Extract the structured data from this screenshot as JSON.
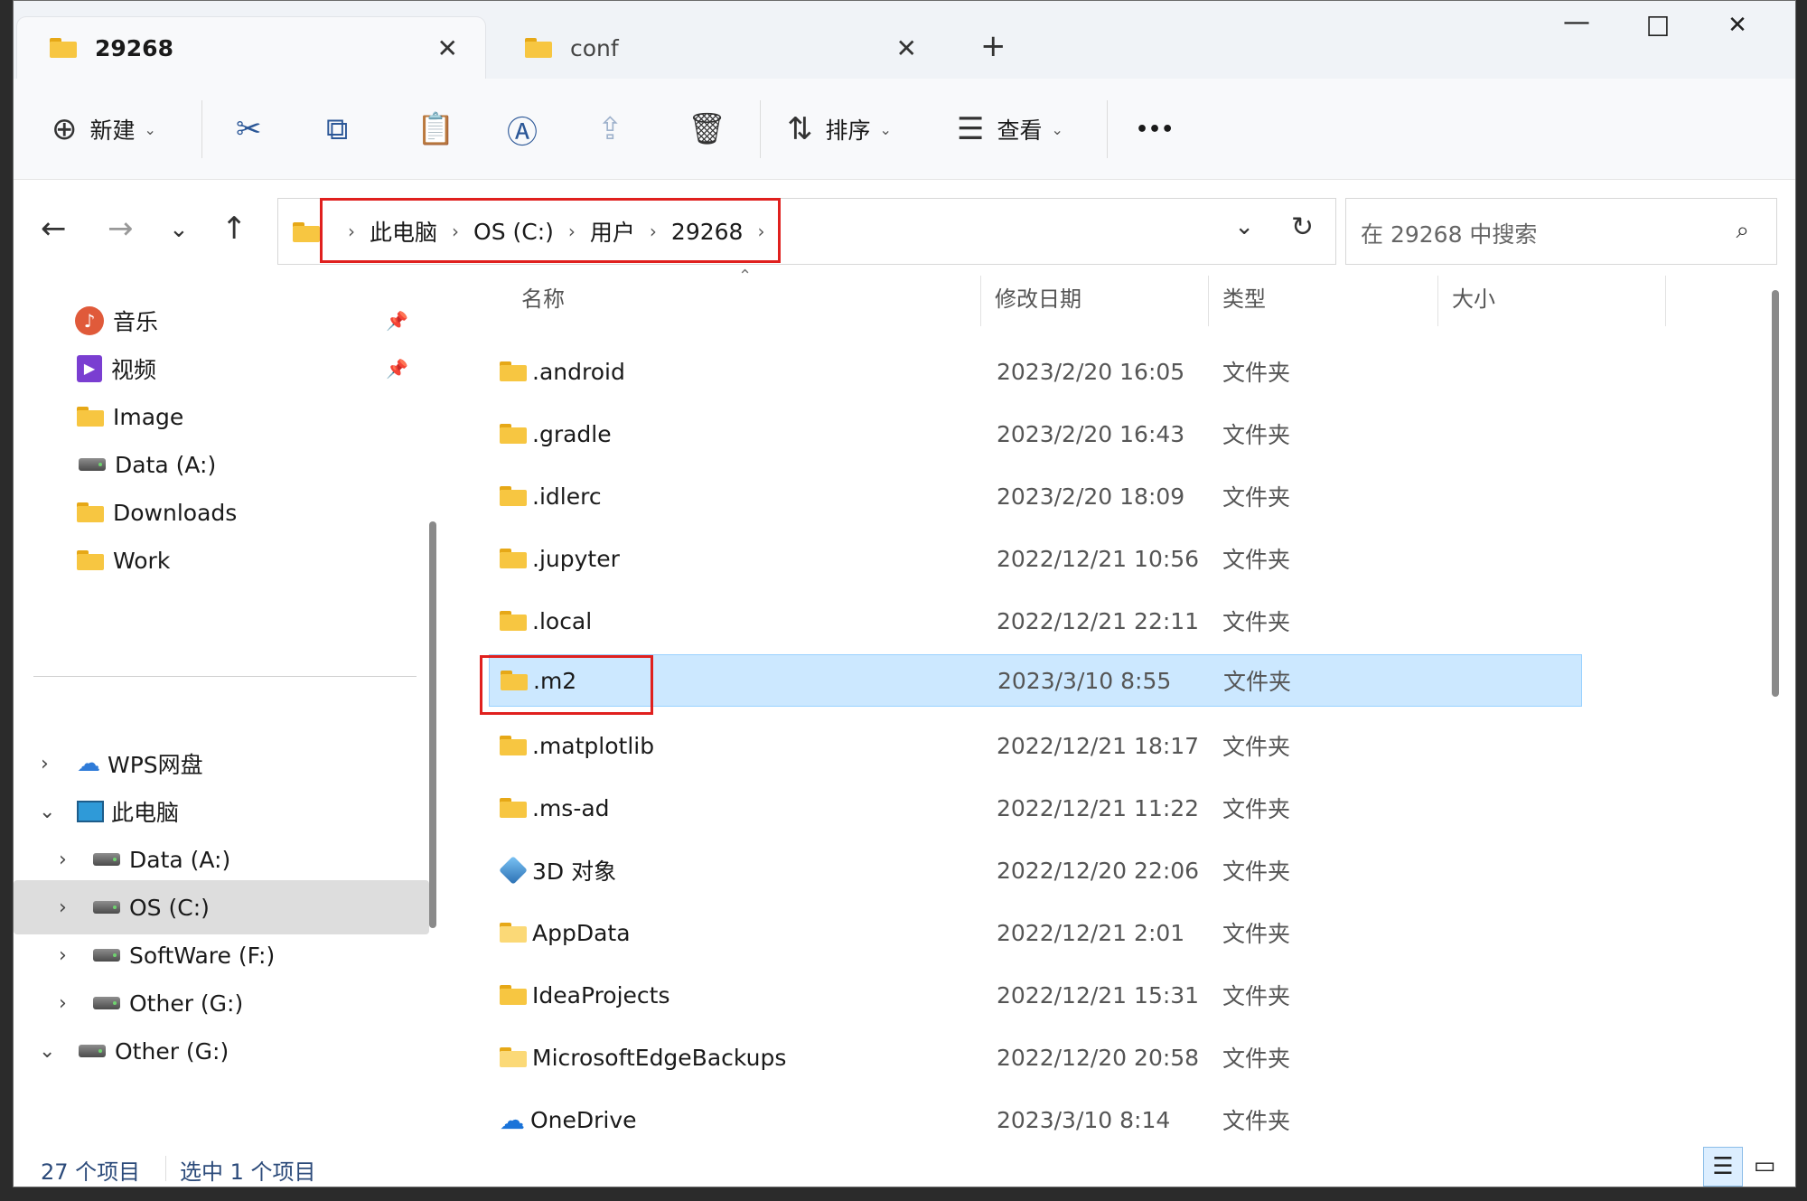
{
  "tabs": [
    {
      "label": "29268",
      "active": true
    },
    {
      "label": "conf",
      "active": false
    }
  ],
  "window_controls": {
    "minimize": "—",
    "maximize": "☐",
    "close": "✕"
  },
  "toolbar": {
    "new_label": "新建",
    "sort_label": "排序",
    "view_label": "查看",
    "more_label": "•••"
  },
  "breadcrumb": [
    "此电脑",
    "OS (C:)",
    "用户",
    "29268"
  ],
  "search": {
    "placeholder": "在 29268 中搜索"
  },
  "sidebar": {
    "quick_access": [
      {
        "label": "音乐",
        "icon": "music-icon",
        "pinned": true
      },
      {
        "label": "视频",
        "icon": "video-icon",
        "pinned": true
      },
      {
        "label": "Image",
        "icon": "folder-icon",
        "pinned": false
      },
      {
        "label": "Data (A:)",
        "icon": "drive-icon",
        "pinned": false
      },
      {
        "label": "Downloads",
        "icon": "folder-icon",
        "pinned": false
      },
      {
        "label": "Work",
        "icon": "folder-icon",
        "pinned": false
      }
    ],
    "tree": [
      {
        "label": "WPS网盘",
        "icon": "cloud-icon",
        "expanded": false,
        "level": 0
      },
      {
        "label": "此电脑",
        "icon": "computer-icon",
        "expanded": true,
        "level": 0
      },
      {
        "label": "Data (A:)",
        "icon": "drive-icon",
        "expanded": false,
        "level": 1
      },
      {
        "label": "OS (C:)",
        "icon": "windows-drive-icon",
        "expanded": false,
        "level": 1,
        "selected": true
      },
      {
        "label": "SoftWare (F:)",
        "icon": "drive-icon",
        "expanded": false,
        "level": 1
      },
      {
        "label": "Other (G:)",
        "icon": "drive-icon",
        "expanded": false,
        "level": 1
      },
      {
        "label": "Other (G:)",
        "icon": "drive-icon",
        "expanded": true,
        "level": 0
      }
    ]
  },
  "columns": {
    "name": "名称",
    "date": "修改日期",
    "type": "类型",
    "size": "大小"
  },
  "files": [
    {
      "name": ".android",
      "date": "2023/2/20 16:05",
      "type": "文件夹",
      "icon": "folder-icon"
    },
    {
      "name": ".gradle",
      "date": "2023/2/20 16:43",
      "type": "文件夹",
      "icon": "folder-icon"
    },
    {
      "name": ".idlerc",
      "date": "2023/2/20 18:09",
      "type": "文件夹",
      "icon": "folder-icon"
    },
    {
      "name": ".jupyter",
      "date": "2022/12/21 10:56",
      "type": "文件夹",
      "icon": "folder-icon"
    },
    {
      "name": ".local",
      "date": "2022/12/21 22:11",
      "type": "文件夹",
      "icon": "folder-icon"
    },
    {
      "name": ".m2",
      "date": "2023/3/10 8:55",
      "type": "文件夹",
      "icon": "folder-icon",
      "selected": true
    },
    {
      "name": ".matplotlib",
      "date": "2022/12/21 18:17",
      "type": "文件夹",
      "icon": "folder-icon"
    },
    {
      "name": ".ms-ad",
      "date": "2022/12/21 11:22",
      "type": "文件夹",
      "icon": "folder-icon"
    },
    {
      "name": "3D 对象",
      "date": "2022/12/20 22:06",
      "type": "文件夹",
      "icon": "3d-objects-icon"
    },
    {
      "name": "AppData",
      "date": "2022/12/21 2:01",
      "type": "文件夹",
      "icon": "folder-icon"
    },
    {
      "name": "IdeaProjects",
      "date": "2022/12/21 15:31",
      "type": "文件夹",
      "icon": "folder-icon"
    },
    {
      "name": "MicrosoftEdgeBackups",
      "date": "2022/12/20 20:58",
      "type": "文件夹",
      "icon": "folder-icon"
    },
    {
      "name": "OneDrive",
      "date": "2023/3/10 8:14",
      "type": "文件夹",
      "icon": "onedrive-icon"
    }
  ],
  "status": {
    "count": "27 个项目",
    "selection": "选中 1 个项目"
  },
  "colors": {
    "accent": "#2b5797",
    "selection": "#cce8ff",
    "highlight": "#e0201e",
    "folder": "#f7c641"
  }
}
